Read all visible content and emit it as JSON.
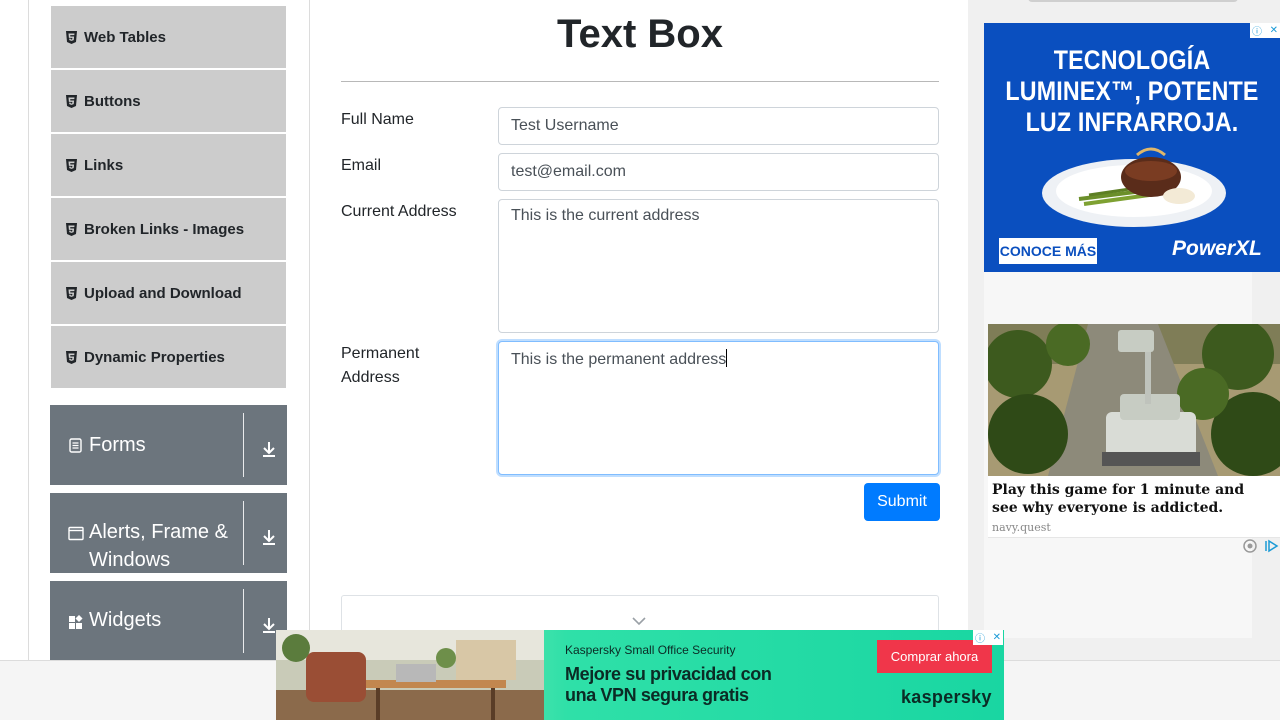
{
  "sidebar": {
    "items": [
      {
        "label": "Web Tables",
        "icon": "html5-icon"
      },
      {
        "label": "Buttons",
        "icon": "html5-icon"
      },
      {
        "label": "Links",
        "icon": "html5-icon"
      },
      {
        "label": "Broken Links - Images",
        "icon": "html5-icon"
      },
      {
        "label": "Upload and Download",
        "icon": "html5-icon"
      },
      {
        "label": "Dynamic Properties",
        "icon": "html5-icon"
      }
    ],
    "groups": [
      {
        "label": "Forms",
        "icon": "document-icon"
      },
      {
        "label": "Alerts, Frame & Windows",
        "icon": "window-icon"
      },
      {
        "label": "Widgets",
        "icon": "widgets-icon"
      }
    ]
  },
  "main": {
    "title": "Text Box",
    "form": {
      "full_name_label": "Full Name",
      "full_name_value": "Test Username",
      "email_label": "Email",
      "email_value": "test@email.com",
      "current_address_label": "Current Address",
      "current_address_value": "This is the current address",
      "permanent_address_label": "Permanent Address",
      "permanent_address_value": "This is the permanent address",
      "submit_label": "Submit"
    }
  },
  "ads": {
    "luminex": {
      "headline": "TECNOLOGÍA LUMINEX™, POTENTE LUZ INFRARROJA.",
      "cta": "CONOCE MÁS",
      "brand": "PowerXL"
    },
    "game": {
      "title": "Play this game for 1 minute and see why everyone is addicted.",
      "source": "navy.quest"
    },
    "kaspersky": {
      "small": "Kaspersky Small Office Security",
      "headline": "Mejore su privacidad con una VPN segura gratis",
      "button": "Comprar ahora",
      "brand": "kaspersky"
    }
  },
  "colors": {
    "accent": "#007bff",
    "sidebar_item_bg": "#cccccc",
    "sidebar_group_bg": "#6c757d"
  }
}
